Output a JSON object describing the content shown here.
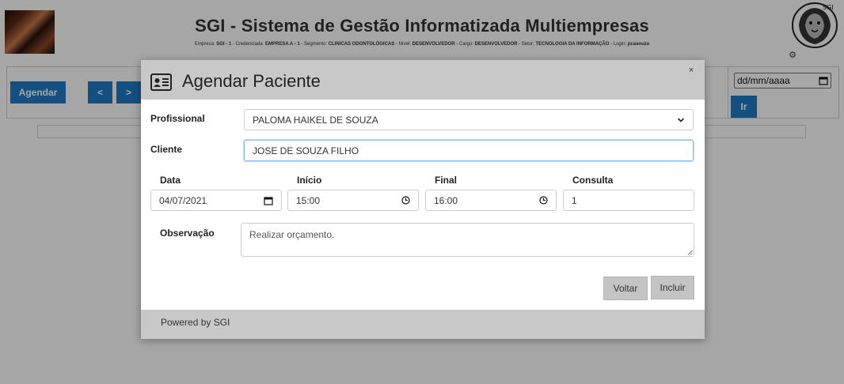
{
  "header": {
    "title": "SGI - Sistema de Gestão Informatizada Multiempresas",
    "meta": [
      {
        "label": "Empresa:",
        "value": "SGI - 1"
      },
      {
        "label": "- Credenciada:",
        "value": "EMPRESA A - 1"
      },
      {
        "label": "- Segmento:",
        "value": "CLINICAS ODONTOLÓGICAS"
      },
      {
        "label": "- Nível:",
        "value": "DESENVOLVEDOR"
      },
      {
        "label": "- Cargo:",
        "value": "DESENVOLVEDOR"
      },
      {
        "label": "- Setor:",
        "value": "TECNOLOGIA DA INFORMAÇÃO"
      },
      {
        "label": "- Login:",
        "value": "pcasouza"
      }
    ],
    "logo_text": "SGI",
    "settings_icon": "gear-icon"
  },
  "toolbar": {
    "agendar_label": "Agendar",
    "prev_label": "<",
    "next_label": ">",
    "date_placeholder": "dd/mm/aaaa",
    "ir_label": "Ir"
  },
  "modal": {
    "title": "Agendar Paciente",
    "title_icon": "id-card-icon",
    "close_label": "×",
    "profissional_label": "Profissional",
    "profissional_value": "PALOMA HAIKEL DE SOUZA",
    "cliente_label": "Cliente",
    "cliente_value": "JOSE DE SOUZA FILHO",
    "data_label": "Data",
    "data_value": "04/07/2021",
    "inicio_label": "Início",
    "inicio_value": "15:00",
    "final_label": "Final",
    "final_value": "16:00",
    "consulta_label": "Consulta",
    "consulta_value": "1",
    "observacao_label": "Observação",
    "observacao_value": "Realizar orçamento.",
    "voltar_label": "Voltar",
    "incluir_label": "Incluir",
    "footer_text": "Powered by SGI"
  },
  "colors": {
    "primary_button": "#1f7ac6",
    "modal_header": "#c8c8c8",
    "overlay": "rgba(0,0,0,0.35)"
  }
}
